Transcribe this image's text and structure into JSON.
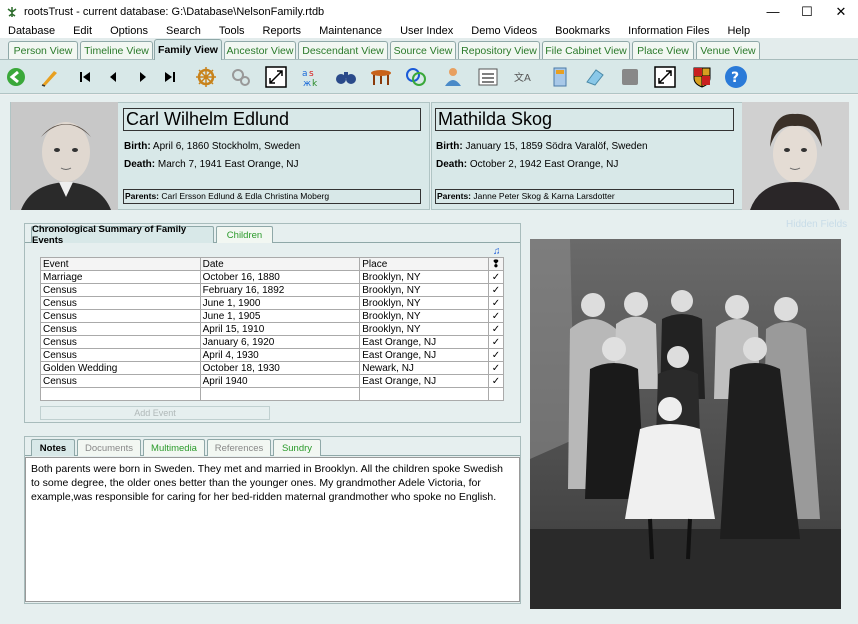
{
  "window": {
    "title": "rootsTrust - current database: G:\\Database\\NelsonFamily.rtdb",
    "minimize": "—",
    "maximize": "☐",
    "close": "✕"
  },
  "menu": [
    "Database",
    "Edit",
    "Options",
    "Search",
    "Tools",
    "Reports",
    "Maintenance",
    "User Index",
    "Demo Videos",
    "Bookmarks",
    "Information Files",
    "Help"
  ],
  "tabs": [
    "Person View",
    "Timeline View",
    "Family View",
    "Ancestor View",
    "Descendant View",
    "Source View",
    "Repository View",
    "File Cabinet View",
    "Place View",
    "Venue View"
  ],
  "active_tab": "Family View",
  "toolbar_icons": [
    "back-arrow-icon",
    "feather-pen-icon",
    "first-record-icon",
    "previous-record-icon",
    "next-record-icon",
    "last-record-icon",
    "ship-wheel-icon",
    "gears-icon",
    "expand-icon",
    "spell-check-icon",
    "binoculars-icon",
    "table-icon",
    "sort-az-icon",
    "people-icon",
    "list-icon",
    "translate-icon",
    "document-icon",
    "eraser-icon",
    "blank-icon",
    "fullscreen-icon",
    "shield-icon",
    "help-icon"
  ],
  "husband": {
    "name": "Carl Wilhelm Edlund",
    "birth_label": "Birth:",
    "birth": "April 6, 1860 Stockholm, Sweden",
    "death_label": "Death:",
    "death": "March 7, 1941 East Orange, NJ",
    "parents_label": "Parents:",
    "parents": "Carl Ersson Edlund & Edla Christina Moberg"
  },
  "wife": {
    "name": "Mathilda Skog",
    "birth_label": "Birth:",
    "birth": "January 15, 1859 Södra Varalöf, Sweden",
    "death_label": "Death:",
    "death": "October 2, 1942 East Orange, NJ",
    "parents_label": "Parents:",
    "parents": "Janne Peter Skog & Karna Larsdotter"
  },
  "hidden_fields": "Hidden Fields",
  "events_tabs": [
    "Chronological Summary of Family Events",
    "Children"
  ],
  "events": {
    "columns": [
      "Event",
      "Date",
      "Place"
    ],
    "check_header": "❢",
    "rows": [
      [
        "Marriage",
        "October 16, 1880",
        "Brooklyn, NY",
        "✓"
      ],
      [
        "Census",
        "February 16, 1892",
        "Brooklyn, NY",
        "✓"
      ],
      [
        "Census",
        "June 1, 1900",
        "Brooklyn, NY",
        "✓"
      ],
      [
        "Census",
        "June 1, 1905",
        "Brooklyn, NY",
        "✓"
      ],
      [
        "Census",
        "April 15, 1910",
        "Brooklyn, NY",
        "✓"
      ],
      [
        "Census",
        "January 6, 1920",
        "East Orange, NJ",
        "✓"
      ],
      [
        "Census",
        "April 4, 1930",
        "East Orange, NJ",
        "✓"
      ],
      [
        "Golden Wedding",
        "October 18, 1930",
        "Newark, NJ",
        "✓"
      ],
      [
        "Census",
        "April 1940",
        "East Orange, NJ",
        "✓"
      ]
    ],
    "add_button": "Add Event"
  },
  "notes_tabs": [
    "Notes",
    "Documents",
    "Multimedia",
    "References",
    "Sundry"
  ],
  "notes_text": "Both parents were born in Sweden. They met and married in Brooklyn. All the children spoke Swedish to some degree, the older ones better than the younger ones. My grandmother Adele Victoria, for example,was responsible for caring for her bed-ridden maternal grandmother who spoke no English."
}
